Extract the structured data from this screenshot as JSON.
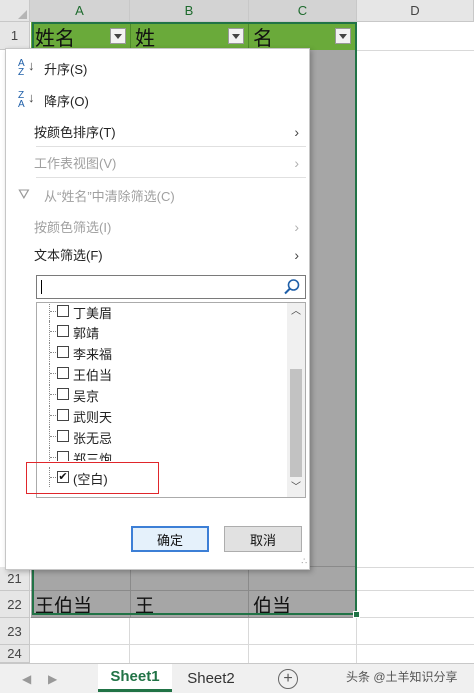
{
  "sheet": {
    "columns": [
      "A",
      "B",
      "C",
      "D"
    ],
    "rows_top": [
      "1"
    ],
    "rows_bottom": [
      "21",
      "22",
      "23",
      "24"
    ],
    "header_cells": [
      "姓名",
      "姓",
      "名"
    ],
    "row22": [
      "王伯当",
      "王",
      "伯当"
    ]
  },
  "menu": {
    "sort_asc": "升序(S)",
    "sort_desc": "降序(O)",
    "sort_by_color": "按颜色排序(T)",
    "sheet_view": "工作表视图(V)",
    "clear_filter": "从“姓名”中清除筛选(C)",
    "filter_by_color": "按颜色筛选(I)",
    "text_filter": "文本筛选(F)",
    "search_placeholder": "",
    "items": [
      {
        "label": "丁美眉",
        "checked": false
      },
      {
        "label": "郭靖",
        "checked": false
      },
      {
        "label": "李来福",
        "checked": false
      },
      {
        "label": "王伯当",
        "checked": false
      },
      {
        "label": "吴京",
        "checked": false
      },
      {
        "label": "武则天",
        "checked": false
      },
      {
        "label": "张无忌",
        "checked": false
      },
      {
        "label": "郑三炮",
        "checked": false
      },
      {
        "label": "(空白)",
        "checked": true
      }
    ],
    "ok_label": "确定",
    "cancel_label": "取消"
  },
  "tabs": {
    "sheet1": "Sheet1",
    "sheet2": "Sheet2",
    "add": "+"
  },
  "watermark": "头条 @土羊知识分享",
  "colors": {
    "excel_green": "#217346",
    "header_fill": "#6aaa3a",
    "filtered_fill": "#a6a6a6",
    "highlight": "#e0262b"
  }
}
